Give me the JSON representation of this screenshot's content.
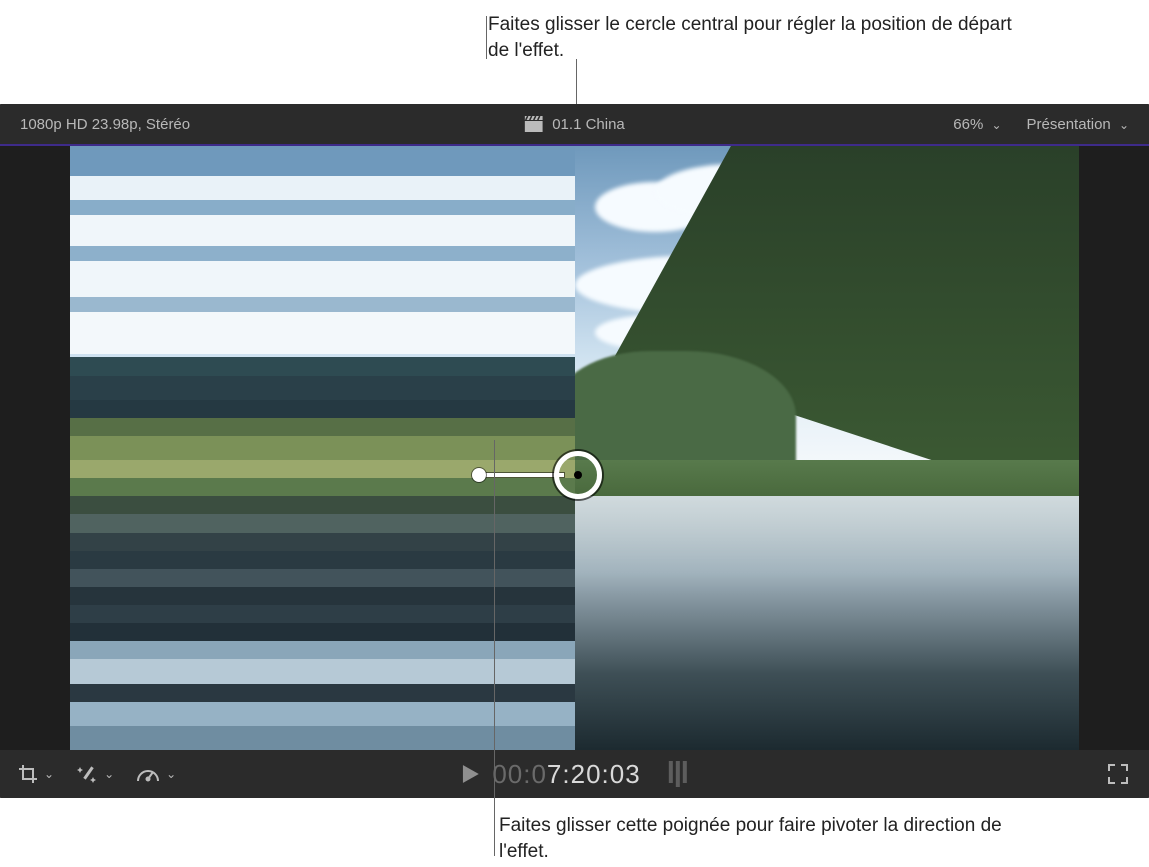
{
  "callouts": {
    "top": "Faites glisser le cercle central pour régler la position de départ de l'effet.",
    "bottom": "Faites glisser cette poignée pour faire pivoter la direction de l'effet."
  },
  "topbar": {
    "format": "1080p HD 23.98p, Stéréo",
    "clip_name": "01.1 China",
    "zoom": "66%",
    "view_menu": "Présentation"
  },
  "playbar": {
    "timecode_prefix": "00:0",
    "timecode": "7:20:03"
  },
  "icons": {
    "clapper": "clapperboard-icon",
    "crop": "crop-icon",
    "wand": "magic-wand-icon",
    "retime": "speed-gauge-icon",
    "play": "play-icon",
    "loop": "loop-icon",
    "fullscreen": "fullscreen-icon"
  }
}
